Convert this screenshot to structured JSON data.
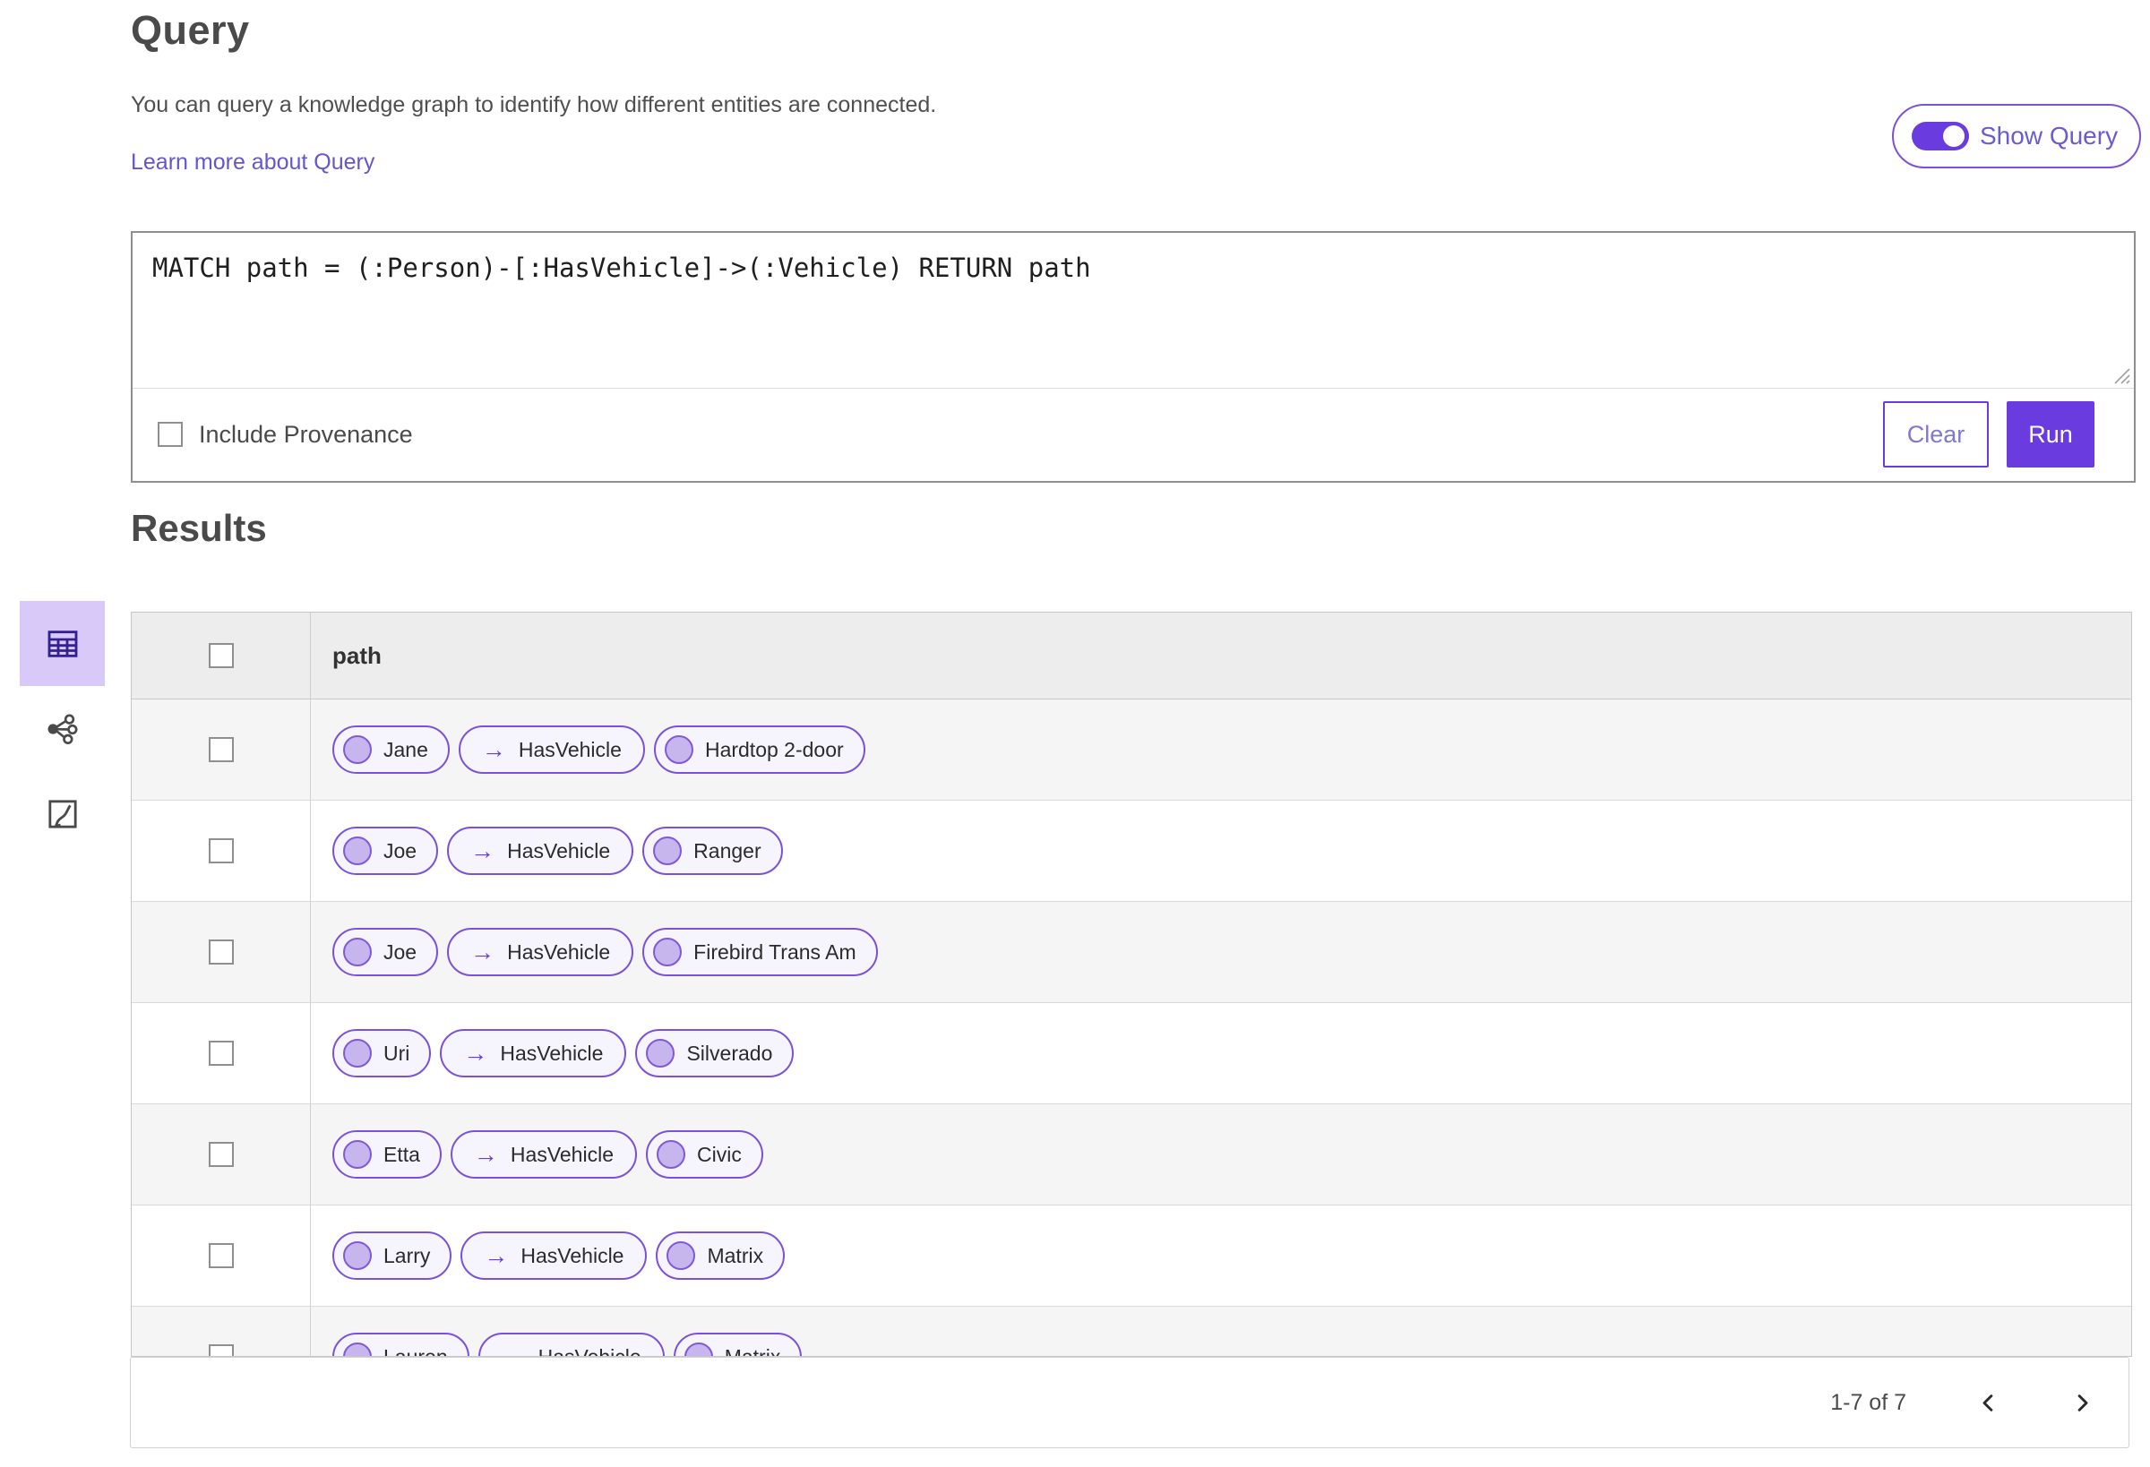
{
  "query": {
    "title": "Query",
    "description": "You can query a knowledge graph to identify how different entities are connected.",
    "learn_more_label": "Learn more about Query",
    "show_query_label": "Show Query",
    "show_query_on": true,
    "text": "MATCH path = (:Person)-[:HasVehicle]->(:Vehicle) RETURN path",
    "include_provenance_label": "Include Provenance",
    "include_provenance_checked": false,
    "clear_label": "Clear",
    "run_label": "Run"
  },
  "results": {
    "title": "Results",
    "column_header": "path"
  },
  "sidebar": {
    "items": [
      {
        "name": "table-view",
        "icon": "table-icon",
        "selected": true
      },
      {
        "name": "graph-view",
        "icon": "link-chart-icon",
        "selected": false
      },
      {
        "name": "map-view",
        "icon": "map-icon",
        "selected": false
      }
    ]
  },
  "table": {
    "arrow_glyph": "→",
    "rows": [
      {
        "source": "Jane",
        "relation": "HasVehicle",
        "target": "Hardtop 2-door"
      },
      {
        "source": "Joe",
        "relation": "HasVehicle",
        "target": "Ranger"
      },
      {
        "source": "Joe",
        "relation": "HasVehicle",
        "target": "Firebird Trans Am"
      },
      {
        "source": "Uri",
        "relation": "HasVehicle",
        "target": "Silverado"
      },
      {
        "source": "Etta",
        "relation": "HasVehicle",
        "target": "Civic"
      },
      {
        "source": "Larry",
        "relation": "HasVehicle",
        "target": "Matrix"
      },
      {
        "source": "Lauren",
        "relation": "HasVehicle",
        "target": "Matrix"
      }
    ]
  },
  "pagination": {
    "range_text": "1-7 of 7",
    "prev_icon": "chevron-left",
    "next_icon": "chevron-right"
  },
  "colors": {
    "accent": "#6a3ce0",
    "pill_border": "#7a52d9",
    "pill_bg": "#f6f4fd",
    "node_fill": "#c7b5ee",
    "link_text": "#6456cd",
    "selected_view_bg": "#d9c9f8",
    "header_row_bg": "#ededed",
    "alt_row_bg": "#f5f5f5"
  }
}
